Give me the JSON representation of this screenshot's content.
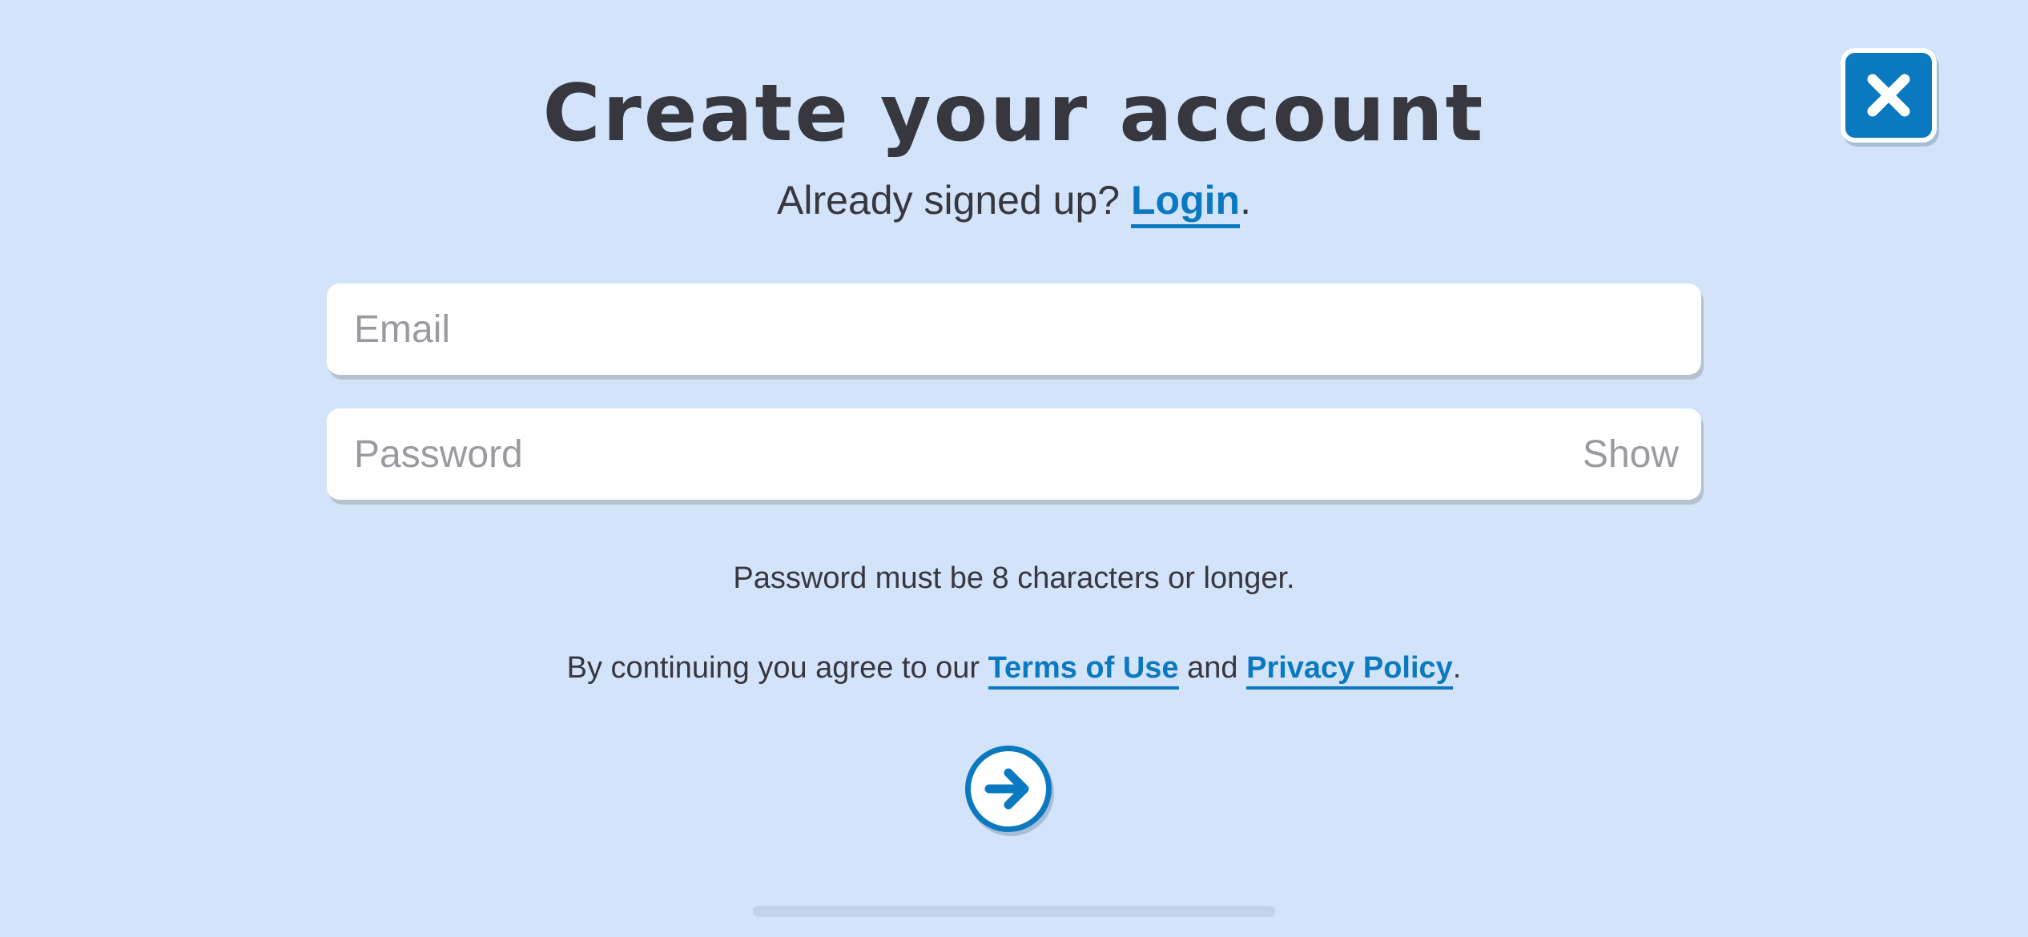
{
  "header": {
    "title": "Create your account",
    "subtitle_prefix": "Already signed up? ",
    "login_link": "Login",
    "subtitle_suffix": "."
  },
  "form": {
    "email": {
      "placeholder": "Email",
      "value": ""
    },
    "password": {
      "placeholder": "Password",
      "value": "",
      "show_label": "Show"
    },
    "password_hint": "Password must be 8 characters or longer."
  },
  "legal": {
    "prefix": "By continuing you agree to our ",
    "terms_link": "Terms of Use",
    "conjunction": " and ",
    "privacy_link": "Privacy Policy",
    "suffix": "."
  },
  "icons": {
    "close": "close-icon",
    "submit": "arrow-right-icon"
  },
  "colors": {
    "background": "#d3e3fa",
    "accent": "#0a79c0",
    "text": "#36373f",
    "placeholder": "#9a9aa0"
  }
}
